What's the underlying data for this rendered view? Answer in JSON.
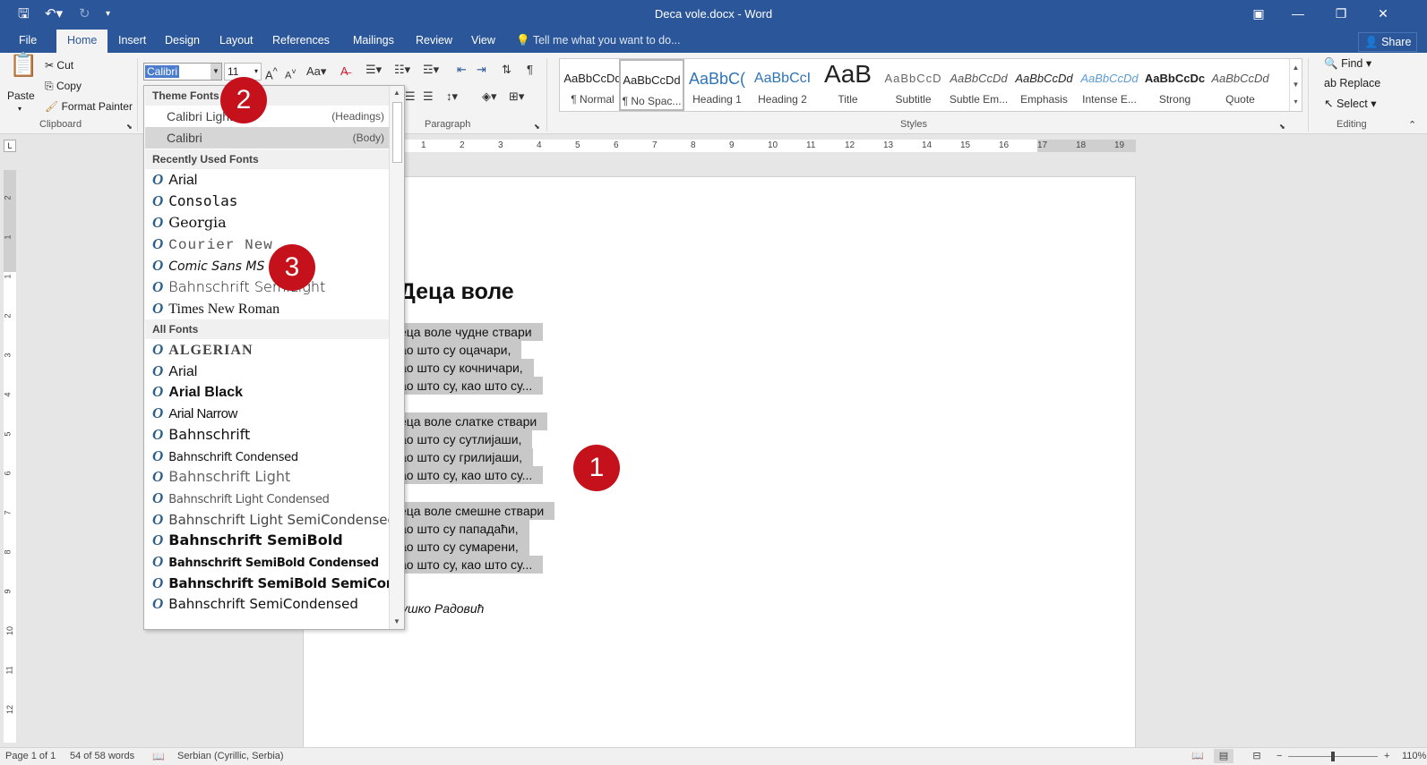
{
  "window": {
    "title": "Deca vole.docx - Word"
  },
  "qat": {
    "save_icon": "save-icon",
    "undo_icon": "undo-icon",
    "redo_icon": "redo-icon",
    "customize_icon": "customize-qat-icon"
  },
  "tabs": [
    "File",
    "Home",
    "Insert",
    "Design",
    "Layout",
    "References",
    "Mailings",
    "Review",
    "View"
  ],
  "active_tab": "Home",
  "tell_me": "Tell me what you want to do...",
  "share": "Share",
  "clipboard": {
    "paste": "Paste",
    "cut": "Cut",
    "copy": "Copy",
    "format_painter": "Format Painter",
    "label": "Clipboard"
  },
  "font": {
    "name": "Calibri",
    "size": "11"
  },
  "paragraph": {
    "label": "Paragraph"
  },
  "styles": {
    "label": "Styles",
    "items": [
      {
        "preview": "AaBbCcDd",
        "name": "¶ Normal"
      },
      {
        "preview": "AaBbCcDd",
        "name": "¶ No Spac..."
      },
      {
        "preview": "AaBbC(",
        "name": "Heading 1"
      },
      {
        "preview": "AaBbCcI",
        "name": "Heading 2"
      },
      {
        "preview": "AaB",
        "name": "Title"
      },
      {
        "preview": "AaBbCcD",
        "name": "Subtitle"
      },
      {
        "preview": "AaBbCcDd",
        "name": "Subtle Em..."
      },
      {
        "preview": "AaBbCcDd",
        "name": "Emphasis"
      },
      {
        "preview": "AaBbCcDd",
        "name": "Intense E..."
      },
      {
        "preview": "AaBbCcDc",
        "name": "Strong"
      },
      {
        "preview": "AaBbCcDd",
        "name": "Quote"
      }
    ]
  },
  "editing": {
    "find": "Find",
    "replace": "Replace",
    "select": "Select",
    "label": "Editing"
  },
  "font_dropdown": {
    "theme_header": "Theme Fonts",
    "theme": [
      {
        "name": "Calibri Light",
        "hint": "(Headings)"
      },
      {
        "name": "Calibri",
        "hint": "(Body)"
      }
    ],
    "recent_header": "Recently Used Fonts",
    "recent": [
      "Arial",
      "Consolas",
      "Georgia",
      "Courier New",
      "Comic Sans MS",
      "Bahnschrift SemiLight",
      "Times New Roman"
    ],
    "all_header": "All Fonts",
    "all": [
      "ALGERIAN",
      "Arial",
      "Arial Black",
      "Arial Narrow",
      "Bahnschrift",
      "Bahnschrift Condensed",
      "Bahnschrift Light",
      "Bahnschrift Light Condensed",
      "Bahnschrift Light SemiCondensed",
      "Bahnschrift SemiBold",
      "Bahnschrift SemiBold Condensed",
      "Bahnschrift SemiBold SemiConden",
      "Bahnschrift SemiCondensed"
    ]
  },
  "document": {
    "title": "Деца воле",
    "lines": [
      "еца воле чудне ствари",
      "ао што су оцачари,",
      "ао што су кочничари,",
      "ао што су, као што су...",
      "еца воле слатке ствари",
      "ао што су сутлијаши,",
      "ао што су грилијаши,",
      "ао што су, као што су...",
      "еца воле смешне ствари",
      "ао што су пападаћи,",
      "ао што су сумарени,",
      "ао што су, као што су..."
    ],
    "author": "ушко Радовић"
  },
  "badges": [
    "1",
    "2",
    "3"
  ],
  "ruler": {
    "ticks": [
      "1",
      "2",
      "3",
      "4",
      "5",
      "6",
      "7",
      "8",
      "9",
      "10",
      "11",
      "12",
      "13",
      "14",
      "15",
      "16",
      "17",
      "18",
      "19"
    ],
    "vticks": [
      "2",
      "1",
      "1",
      "2",
      "3",
      "4",
      "5",
      "6",
      "7",
      "8",
      "9",
      "10",
      "11",
      "12"
    ]
  },
  "status": {
    "page": "Page 1 of 1",
    "words": "54 of 58 words",
    "language": "Serbian (Cyrillic, Serbia)",
    "zoom": "110%"
  },
  "colors": {
    "accent": "#2b579a",
    "badge": "#c4111b"
  }
}
